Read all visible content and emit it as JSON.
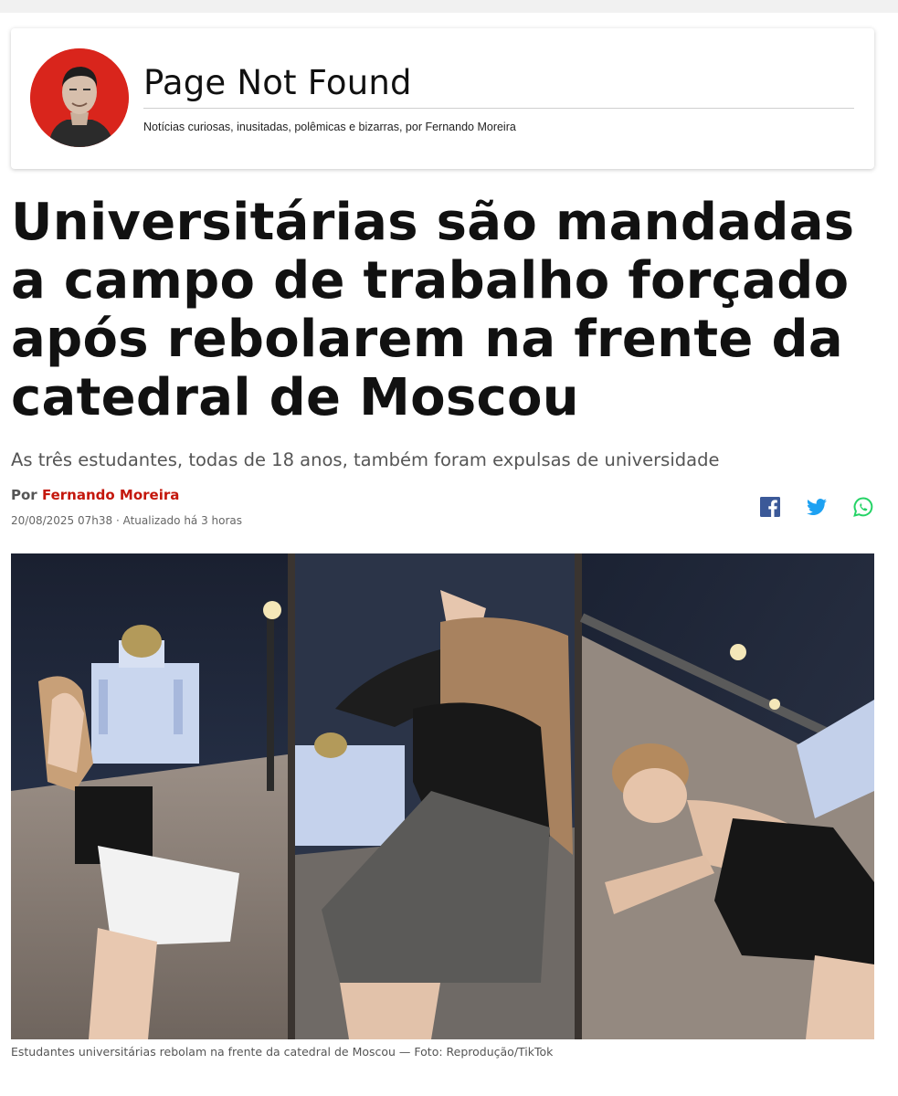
{
  "blog": {
    "name": "Page Not Found",
    "tagline": "Notícias curiosas, inusitadas, polêmicas e bizarras, por Fernando Moreira"
  },
  "article": {
    "headline": "Universitárias são mandadas a campo de trabalho forçado após rebolarem na frente da catedral de Moscou",
    "subtitle": "As três estudantes, todas de 18 anos, também foram expulsas de universidade",
    "byline_prefix": "Por",
    "author": "Fernando Moreira",
    "dateline": "20/08/2025 07h38 · Atualizado há 3 horas",
    "caption": "Estudantes universitárias rebolam na frente da catedral de Moscou — Foto: Reprodução/TikTok"
  },
  "share": {
    "icons": [
      "facebook-icon",
      "twitter-icon",
      "whatsapp-icon"
    ]
  },
  "colors": {
    "author_red": "#c4170c",
    "avatar_red": "#d9251c",
    "facebook": "#3b5998",
    "twitter": "#1da1f2",
    "whatsapp": "#25d366"
  }
}
